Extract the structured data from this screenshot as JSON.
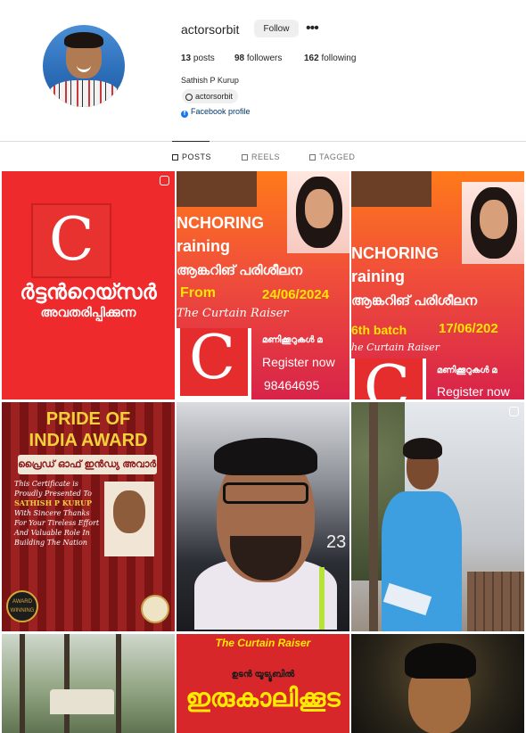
{
  "profile": {
    "username": "actorsorbit",
    "follow_label": "Follow",
    "more_label": "•••",
    "posts_count": "13",
    "posts_label": "posts",
    "followers_count": "98",
    "followers_label": "followers",
    "following_count": "162",
    "following_label": "following",
    "full_name": "Sathish P Kurup",
    "threads_handle": "actorsorbit",
    "facebook_label": "Facebook profile"
  },
  "tabs": [
    {
      "label": "POSTS",
      "active": true
    },
    {
      "label": "REELS",
      "active": false
    },
    {
      "label": "TAGGED",
      "active": false
    }
  ],
  "grid": {
    "tile1": {
      "line1": "ർട്ടൻറെയ്സർ",
      "line2": "അവതരിപ്പിക്കുന്ന",
      "logo_letter": "C"
    },
    "tile2": {
      "title": "NCHORING",
      "subtitle": "raining",
      "mal": "ആങ്കറിങ് പരിശീലന",
      "from": "From",
      "date": "24/06/2024",
      "brand": "The Curtain Raiser",
      "mal2": "മണിക്കൂറുകൾ മ",
      "register": "Register now",
      "phone": "98464695",
      "logo_letter": "C"
    },
    "tile3": {
      "title": "NCHORING",
      "subtitle": "raining",
      "mal": "ആങ്കറിങ് പരിശീലന",
      "batch": "6th batch",
      "date": "17/06/202",
      "brand": "he Curtain Raiser",
      "mal2": "മണിക്കൂറുകൾ മ",
      "register": "Register now",
      "logo_letter": "C"
    },
    "tile4": {
      "line1": "PRIDE OF",
      "line2": "INDIA AWARD",
      "band": "പ്രൈഡ് ഓഫ് ഇൻഡ്യ അവാർഡ്",
      "cert_intro": "This Certificate is Proudly Presented To",
      "name": "SATHISH P KURUP",
      "cert_body": "With Sincere Thanks For Your Tireless Effort And Valuable Role In Building The Nation",
      "badge": "AWARD WINNING"
    },
    "tile5": {
      "number": "23"
    },
    "tile8": {
      "brand": "The Curtain Raiser",
      "line1": "ഉടൻ യൂട്യൂബിൽ",
      "line2": "ഇരുകാലിക്കൂട"
    }
  }
}
